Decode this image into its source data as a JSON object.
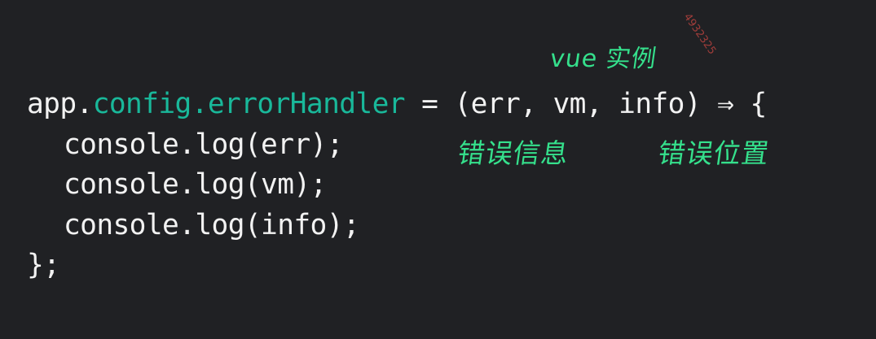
{
  "code": {
    "lines": [
      {
        "app_prefix": "app.",
        "highlight": "config.errorHandler",
        "rest": " = (err, vm, info) ⇒ {"
      },
      {
        "text": "console.log(err);"
      },
      {
        "text": "console.log(vm);"
      },
      {
        "text": "console.log(info);"
      },
      {
        "text": "};"
      }
    ]
  },
  "annotations": {
    "vm_label": "vue 实例",
    "err_label": "错误信息",
    "info_label": "错误位置"
  },
  "watermark": "4932325",
  "colors": {
    "background": "#202124",
    "code_text": "#f2f2f2",
    "highlight": "#19b89a",
    "annotation": "#35e08c",
    "watermark": "#b8433f"
  }
}
